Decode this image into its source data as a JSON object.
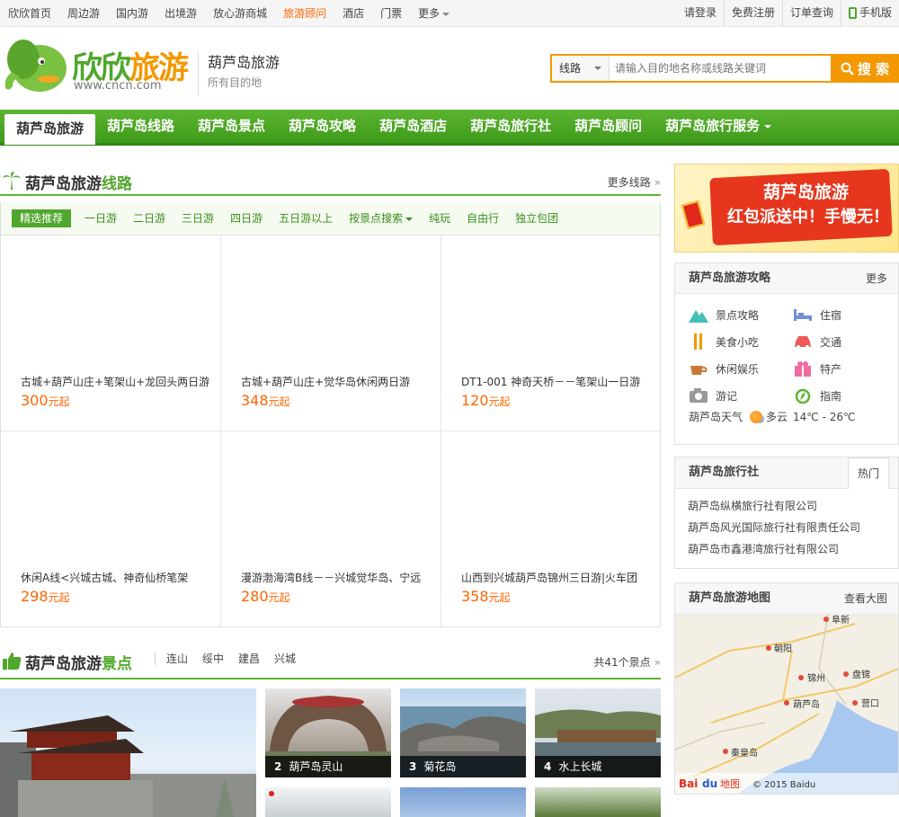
{
  "topnav": {
    "items": [
      "欣欣首页",
      "周边游",
      "国内游",
      "出境游",
      "放心游商城",
      "旅游顾问",
      "酒店",
      "门票",
      "更多"
    ],
    "active_index": 5
  },
  "toplinks": {
    "login": "请登录",
    "register": "免费注册",
    "order": "订单查询",
    "mobile": "手机版"
  },
  "logo": {
    "text_a": "欣欣",
    "text_b": "旅游",
    "url": "www.cncn.com"
  },
  "city": {
    "name": "葫芦岛旅游",
    "sub": "所有目的地"
  },
  "search": {
    "type": "线路",
    "placeholder": "请输入目的地名称或线路关键词",
    "button": "搜 索"
  },
  "mainnav": {
    "tabs": [
      "葫芦岛旅游",
      "葫芦岛线路",
      "葫芦岛景点",
      "葫芦岛攻略",
      "葫芦岛酒店",
      "葫芦岛旅行社",
      "葫芦岛顾问",
      "葫芦岛旅行服务"
    ]
  },
  "routes": {
    "title_a": "葫芦岛旅游",
    "title_b": "线路",
    "more": "更多线路",
    "filters": [
      "精选推荐",
      "一日游",
      "二日游",
      "三日游",
      "四日游",
      "五日游以上",
      "按景点搜索",
      "纯玩",
      "自由行",
      "独立包团"
    ],
    "price_unit": "元起",
    "items": [
      {
        "name": "古城+葫芦山庄+笔架山+龙回头两日游",
        "price": "300"
      },
      {
        "name": "古城+葫芦山庄+觉华岛休闲两日游",
        "price": "348"
      },
      {
        "name": "DT1-001 神奇天桥－－笔架山一日游",
        "price": "120"
      },
      {
        "name": "休闲A线<兴城古城、神奇仙桥笔架",
        "price": "298"
      },
      {
        "name": "漫游渤海湾B线－－兴城觉华岛、宁远",
        "price": "280"
      },
      {
        "name": "山西到兴城葫芦岛锦州三日游|火车团",
        "price": "358"
      }
    ]
  },
  "sights": {
    "title_a": "葫芦岛旅游",
    "title_b": "景点",
    "tags": [
      "连山",
      "绥中",
      "建昌",
      "兴城"
    ],
    "count": "共41个景点",
    "items": [
      {
        "num": "2",
        "name": "葫芦岛灵山"
      },
      {
        "num": "3",
        "name": "菊花岛"
      },
      {
        "num": "4",
        "name": "水上长城"
      }
    ]
  },
  "promo": {
    "line1": "葫芦岛旅游",
    "line2": "红包派送中！手慢无！"
  },
  "guide": {
    "title": "葫芦岛旅游攻略",
    "more": "更多",
    "items": [
      {
        "label": "景点攻略",
        "icon": "mountain-icon"
      },
      {
        "label": "住宿",
        "icon": "bed-icon"
      },
      {
        "label": "美食小吃",
        "icon": "fork-icon"
      },
      {
        "label": "交通",
        "icon": "car-icon"
      },
      {
        "label": "休闲娱乐",
        "icon": "coffee-icon"
      },
      {
        "label": "特产",
        "icon": "gift-icon"
      },
      {
        "label": "游记",
        "icon": "camera-icon"
      },
      {
        "label": "指南",
        "icon": "compass-icon"
      }
    ],
    "weather_label": "葫芦岛天气",
    "weather_cond": "多云",
    "weather_temp": "14℃ - 26℃"
  },
  "agency": {
    "title": "葫芦岛旅行社",
    "tab": "热门",
    "items": [
      "葫芦岛纵横旅行社有限公司",
      "葫芦岛风光国际旅行社有限责任公司",
      "葫芦岛市鑫港湾旅行社有限公司"
    ]
  },
  "map": {
    "title": "葫芦岛旅游地图",
    "more": "查看大图",
    "copyright": "© 2015 Baidu",
    "logo_a": "Bai",
    "logo_b": "du",
    "logo_c": "地图",
    "cities": [
      "阜新",
      "朝阳",
      "锦州",
      "盘锦",
      "葫芦岛",
      "营口",
      "秦皇岛"
    ]
  },
  "colors": {
    "green": "#4fa72b",
    "orange": "#f39800",
    "price": "#ff6600"
  }
}
